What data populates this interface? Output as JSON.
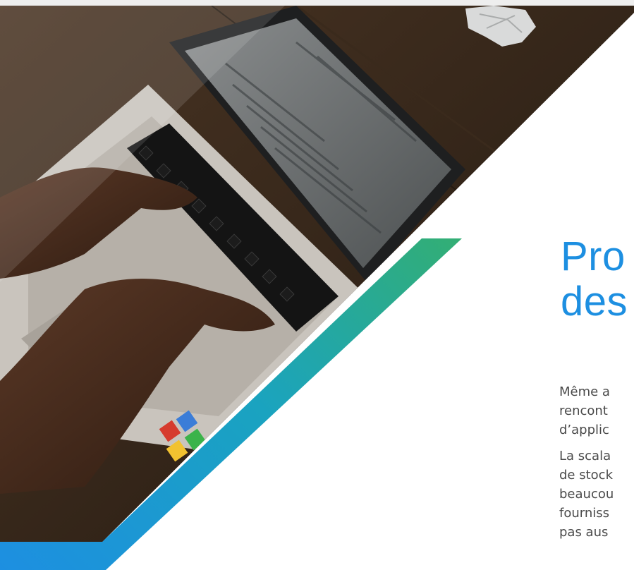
{
  "page": {
    "title_lines": [
      "Pro",
      "des"
    ],
    "paragraphs": [
      [
        "Même a",
        "rencont",
        "d’applic"
      ],
      [
        "La scala",
        "de stock",
        "beaucou",
        "fourniss",
        "pas aus"
      ]
    ]
  },
  "colors": {
    "accent_blue": "#1d8fe1",
    "accent_green": "#78c42a",
    "body_text": "#4a4a4a",
    "top_bar": "#eeeeee"
  },
  "image": {
    "subject": "hands-typing-on-laptop-icon"
  }
}
